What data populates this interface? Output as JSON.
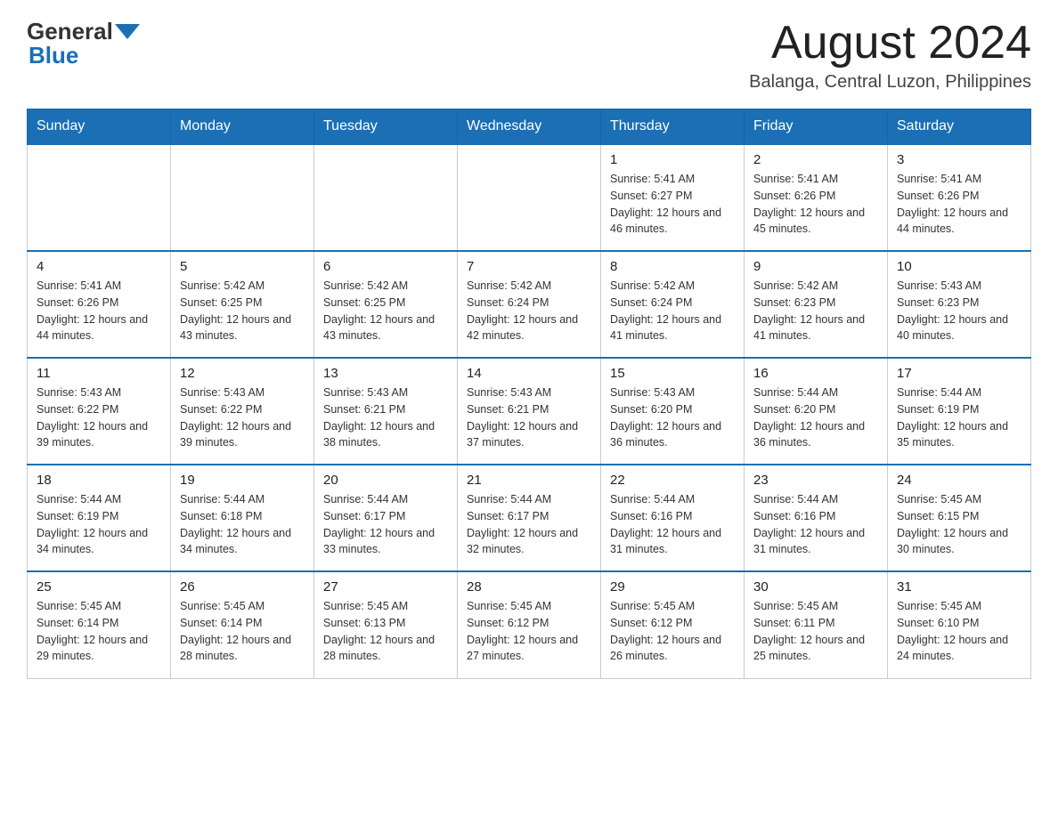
{
  "logo": {
    "general": "General",
    "blue": "Blue"
  },
  "title": {
    "month_year": "August 2024",
    "location": "Balanga, Central Luzon, Philippines"
  },
  "weekdays": [
    "Sunday",
    "Monday",
    "Tuesday",
    "Wednesday",
    "Thursday",
    "Friday",
    "Saturday"
  ],
  "weeks": [
    [
      {
        "day": "",
        "info": ""
      },
      {
        "day": "",
        "info": ""
      },
      {
        "day": "",
        "info": ""
      },
      {
        "day": "",
        "info": ""
      },
      {
        "day": "1",
        "info": "Sunrise: 5:41 AM\nSunset: 6:27 PM\nDaylight: 12 hours and 46 minutes."
      },
      {
        "day": "2",
        "info": "Sunrise: 5:41 AM\nSunset: 6:26 PM\nDaylight: 12 hours and 45 minutes."
      },
      {
        "day": "3",
        "info": "Sunrise: 5:41 AM\nSunset: 6:26 PM\nDaylight: 12 hours and 44 minutes."
      }
    ],
    [
      {
        "day": "4",
        "info": "Sunrise: 5:41 AM\nSunset: 6:26 PM\nDaylight: 12 hours and 44 minutes."
      },
      {
        "day": "5",
        "info": "Sunrise: 5:42 AM\nSunset: 6:25 PM\nDaylight: 12 hours and 43 minutes."
      },
      {
        "day": "6",
        "info": "Sunrise: 5:42 AM\nSunset: 6:25 PM\nDaylight: 12 hours and 43 minutes."
      },
      {
        "day": "7",
        "info": "Sunrise: 5:42 AM\nSunset: 6:24 PM\nDaylight: 12 hours and 42 minutes."
      },
      {
        "day": "8",
        "info": "Sunrise: 5:42 AM\nSunset: 6:24 PM\nDaylight: 12 hours and 41 minutes."
      },
      {
        "day": "9",
        "info": "Sunrise: 5:42 AM\nSunset: 6:23 PM\nDaylight: 12 hours and 41 minutes."
      },
      {
        "day": "10",
        "info": "Sunrise: 5:43 AM\nSunset: 6:23 PM\nDaylight: 12 hours and 40 minutes."
      }
    ],
    [
      {
        "day": "11",
        "info": "Sunrise: 5:43 AM\nSunset: 6:22 PM\nDaylight: 12 hours and 39 minutes."
      },
      {
        "day": "12",
        "info": "Sunrise: 5:43 AM\nSunset: 6:22 PM\nDaylight: 12 hours and 39 minutes."
      },
      {
        "day": "13",
        "info": "Sunrise: 5:43 AM\nSunset: 6:21 PM\nDaylight: 12 hours and 38 minutes."
      },
      {
        "day": "14",
        "info": "Sunrise: 5:43 AM\nSunset: 6:21 PM\nDaylight: 12 hours and 37 minutes."
      },
      {
        "day": "15",
        "info": "Sunrise: 5:43 AM\nSunset: 6:20 PM\nDaylight: 12 hours and 36 minutes."
      },
      {
        "day": "16",
        "info": "Sunrise: 5:44 AM\nSunset: 6:20 PM\nDaylight: 12 hours and 36 minutes."
      },
      {
        "day": "17",
        "info": "Sunrise: 5:44 AM\nSunset: 6:19 PM\nDaylight: 12 hours and 35 minutes."
      }
    ],
    [
      {
        "day": "18",
        "info": "Sunrise: 5:44 AM\nSunset: 6:19 PM\nDaylight: 12 hours and 34 minutes."
      },
      {
        "day": "19",
        "info": "Sunrise: 5:44 AM\nSunset: 6:18 PM\nDaylight: 12 hours and 34 minutes."
      },
      {
        "day": "20",
        "info": "Sunrise: 5:44 AM\nSunset: 6:17 PM\nDaylight: 12 hours and 33 minutes."
      },
      {
        "day": "21",
        "info": "Sunrise: 5:44 AM\nSunset: 6:17 PM\nDaylight: 12 hours and 32 minutes."
      },
      {
        "day": "22",
        "info": "Sunrise: 5:44 AM\nSunset: 6:16 PM\nDaylight: 12 hours and 31 minutes."
      },
      {
        "day": "23",
        "info": "Sunrise: 5:44 AM\nSunset: 6:16 PM\nDaylight: 12 hours and 31 minutes."
      },
      {
        "day": "24",
        "info": "Sunrise: 5:45 AM\nSunset: 6:15 PM\nDaylight: 12 hours and 30 minutes."
      }
    ],
    [
      {
        "day": "25",
        "info": "Sunrise: 5:45 AM\nSunset: 6:14 PM\nDaylight: 12 hours and 29 minutes."
      },
      {
        "day": "26",
        "info": "Sunrise: 5:45 AM\nSunset: 6:14 PM\nDaylight: 12 hours and 28 minutes."
      },
      {
        "day": "27",
        "info": "Sunrise: 5:45 AM\nSunset: 6:13 PM\nDaylight: 12 hours and 28 minutes."
      },
      {
        "day": "28",
        "info": "Sunrise: 5:45 AM\nSunset: 6:12 PM\nDaylight: 12 hours and 27 minutes."
      },
      {
        "day": "29",
        "info": "Sunrise: 5:45 AM\nSunset: 6:12 PM\nDaylight: 12 hours and 26 minutes."
      },
      {
        "day": "30",
        "info": "Sunrise: 5:45 AM\nSunset: 6:11 PM\nDaylight: 12 hours and 25 minutes."
      },
      {
        "day": "31",
        "info": "Sunrise: 5:45 AM\nSunset: 6:10 PM\nDaylight: 12 hours and 24 minutes."
      }
    ]
  ]
}
